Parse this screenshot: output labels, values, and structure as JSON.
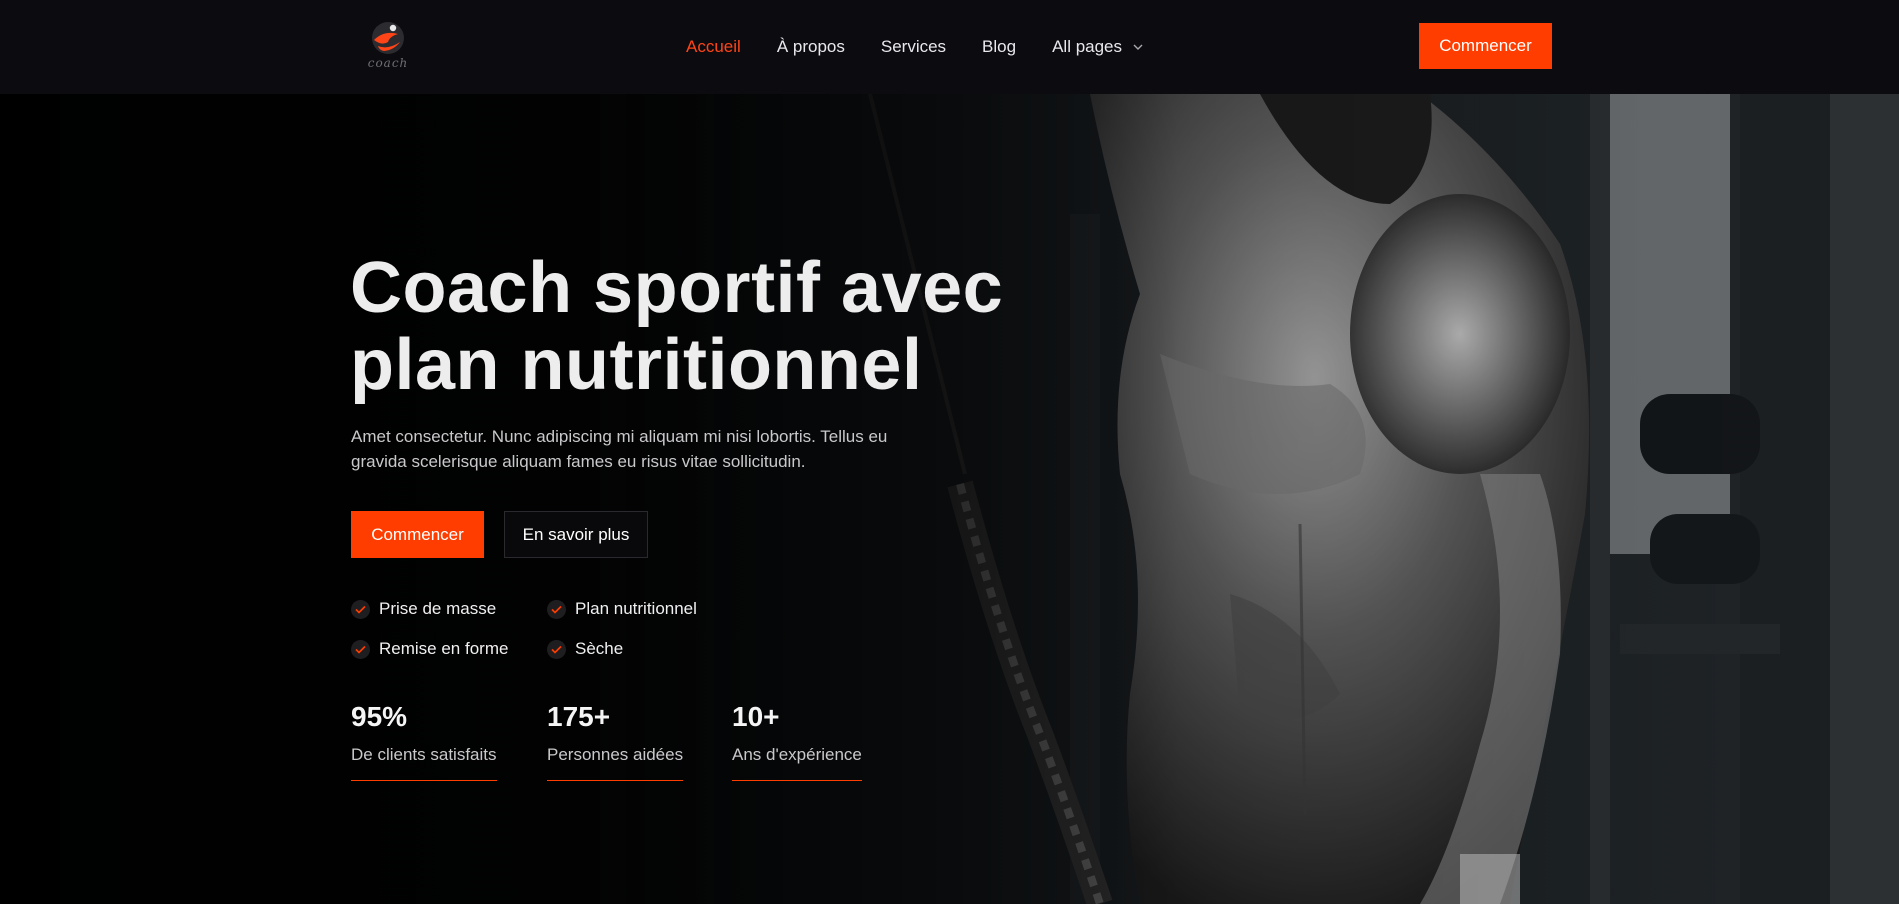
{
  "nav": {
    "logo_text": "coach",
    "links": [
      "Accueil",
      "À propos",
      "Services",
      "Blog",
      "All pages"
    ],
    "cta": "Commencer",
    "accent": "#ff3d00"
  },
  "hero": {
    "title_line1": "Coach sportif avec",
    "title_line2": "plan nutritionnel",
    "subtitle": "Amet consectetur. Nunc adipiscing mi aliquam mi nisi lobortis. Tellus eu gravida scelerisque aliquam fames eu risus vitae sollicitudin.",
    "primary_button": "Commencer",
    "secondary_button": "En savoir plus",
    "features": [
      "Prise de masse",
      "Plan nutritionnel",
      "Remise en forme",
      "Sèche"
    ],
    "stats": [
      {
        "value": "95%",
        "label": "De clients satisfaits"
      },
      {
        "value": "175+",
        "label": "Personnes aidées"
      },
      {
        "value": "10+",
        "label": "Ans d'expérience"
      }
    ]
  },
  "icons": [
    "coach-logo",
    "chevron-down-icon",
    "check-icon"
  ]
}
